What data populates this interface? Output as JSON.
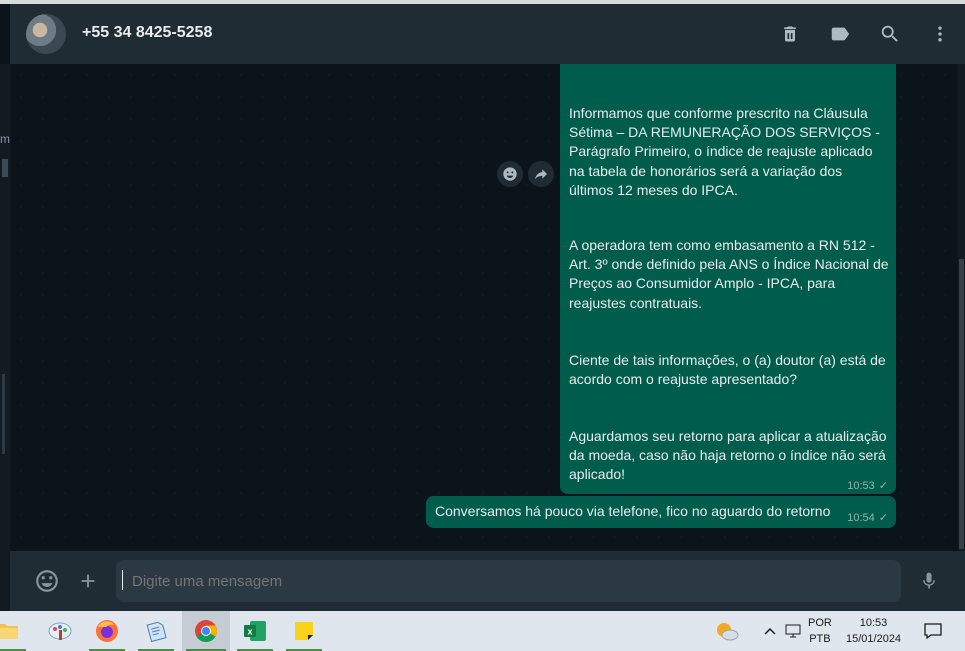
{
  "header": {
    "contact_name": "+55 34 8425-5258",
    "icons": [
      "delete-icon",
      "label-icon",
      "search-icon",
      "menu-icon"
    ]
  },
  "sidebar": {
    "partial_text": "m"
  },
  "messages": [
    {
      "paragraphs": [
        "Informamos que conforme prescrito na Cláusula Sétima – DA REMUNERAÇÃO DOS SERVIÇOS - Parágrafo Primeiro, o índice de reajuste aplicado na tabela de honorários será a variação dos últimos 12 meses do IPCA.",
        "A operadora tem como embasamento a RN 512 - Art. 3º onde definido pela ANS o Índice Nacional de Preços ao Consumidor Amplo - IPCA, para reajustes contratuais.",
        "Ciente de tais informações, o (a) doutor (a) está de acordo com o reajuste apresentado?",
        "Aguardamos seu retorno para aplicar a atualização da moeda, caso não haja retorno o índice não será aplicado!"
      ],
      "time": "10:53",
      "status": "✓"
    },
    {
      "text": "Conversamos há pouco via telefone, fico no aguardo do retorno",
      "time": "10:54",
      "status": "✓"
    }
  ],
  "composer": {
    "placeholder": "Digite uma mensagem"
  },
  "taskbar": {
    "apps": [
      "file-explorer-icon",
      "paint-icon",
      "firefox-icon",
      "notepad-icon",
      "chrome-icon",
      "excel-icon",
      "sticky-notes-icon"
    ],
    "active_app": "chrome-icon",
    "lang_top": "POR",
    "lang_bottom": "PTB",
    "time": "10:53",
    "date": "15/01/2024"
  },
  "colors": {
    "bubble": "#005c4b",
    "header": "#202c33",
    "background": "#0b141a",
    "text": "#e9edef"
  }
}
